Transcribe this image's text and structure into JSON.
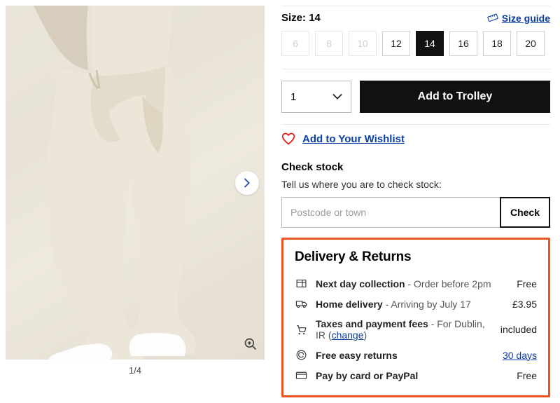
{
  "gallery": {
    "counter": "1/4"
  },
  "size": {
    "label_prefix": "Size: ",
    "selected": "14",
    "guide": "Size guide",
    "options": [
      {
        "v": "6",
        "state": "disabled"
      },
      {
        "v": "8",
        "state": "disabled"
      },
      {
        "v": "10",
        "state": "disabled"
      },
      {
        "v": "12",
        "state": ""
      },
      {
        "v": "14",
        "state": "selected"
      },
      {
        "v": "16",
        "state": ""
      },
      {
        "v": "18",
        "state": ""
      },
      {
        "v": "20",
        "state": ""
      }
    ]
  },
  "buy": {
    "qty": "1",
    "button": "Add to Trolley"
  },
  "wishlist": {
    "label": "Add to Your Wishlist"
  },
  "stock": {
    "title": "Check stock",
    "subtitle": "Tell us where you are to check stock:",
    "placeholder": "Postcode or town",
    "button": "Check"
  },
  "delivery": {
    "title": "Delivery & Returns",
    "rows": [
      {
        "bold": "Next day collection",
        "detail": " - Order before 2pm",
        "price": "Free"
      },
      {
        "bold": "Home delivery",
        "detail": " - Arriving by July 17",
        "price": "£3.95"
      },
      {
        "bold": "Taxes and payment fees",
        "detail": " - For Dublin, IR (",
        "link": "change",
        "after_link": ")",
        "price": "included"
      },
      {
        "bold": "Free easy returns",
        "detail": "",
        "price_link": "30 days"
      },
      {
        "bold": "Pay by card or PayPal",
        "detail": "",
        "price": "Free"
      }
    ]
  }
}
